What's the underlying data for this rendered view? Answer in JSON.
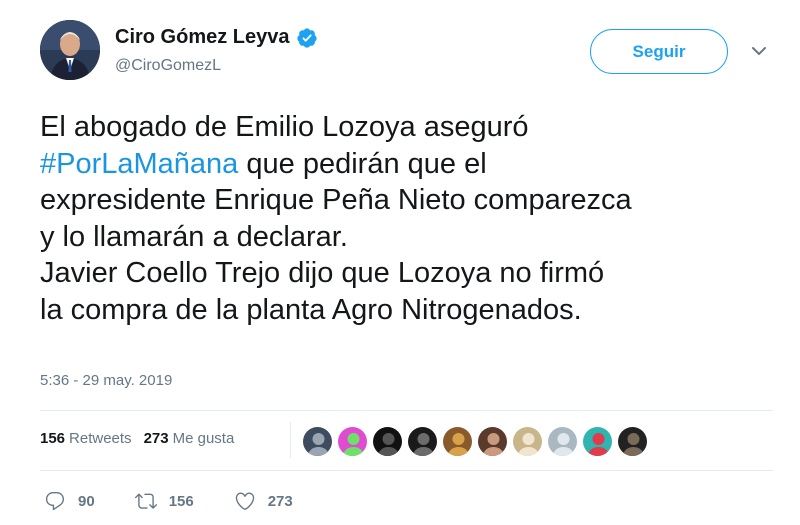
{
  "user": {
    "name": "Ciro Gómez Leyva",
    "handle": "@CiroGomezL",
    "verified": true
  },
  "follow_button": {
    "label": "Seguir"
  },
  "tweet": {
    "segments": [
      {
        "text": "El abogado de Emilio Lozoya aseguró\n",
        "hashtag": false
      },
      {
        "text": "#PorLaMañana",
        "hashtag": true
      },
      {
        "text": " que pedirán que el\nexpresidente Enrique Peña Nieto comparezca\ny lo llamarán a declarar.\nJavier Coello Trejo dijo que Lozoya no firmó\nla compra de la planta Agro Nitrogenados.",
        "hashtag": false
      }
    ],
    "timestamp": "5:36 - 29 may. 2019"
  },
  "stats": {
    "retweets_count": "156",
    "retweets_label": "Retweets",
    "likes_count": "273",
    "likes_label": "Me gusta"
  },
  "likers": [
    {
      "icon": "avatar-landscape",
      "colors": [
        "#3d4c5e",
        "#9aa5b1"
      ]
    },
    {
      "icon": "avatar-colorful-logo",
      "colors": [
        "#e04bd0",
        "#6ee06a"
      ]
    },
    {
      "icon": "avatar-dark-logo",
      "colors": [
        "#111111",
        "#555555"
      ]
    },
    {
      "icon": "avatar-dark-portrait",
      "colors": [
        "#1a1a1a",
        "#6b6b6b"
      ]
    },
    {
      "icon": "avatar-patterned",
      "colors": [
        "#8a5a2b",
        "#d8a24a"
      ]
    },
    {
      "icon": "avatar-portrait-woman",
      "colors": [
        "#5a3a2a",
        "#c99a80"
      ]
    },
    {
      "icon": "avatar-portrait-blonde",
      "colors": [
        "#c9b58a",
        "#f0e6d0"
      ]
    },
    {
      "icon": "avatar-default",
      "colors": [
        "#aab8c2",
        "#e1e8ed"
      ]
    },
    {
      "icon": "avatar-teal-character",
      "colors": [
        "#2fb5b0",
        "#e23a4a"
      ]
    },
    {
      "icon": "avatar-dark-portrait-2",
      "colors": [
        "#222222",
        "#7a6a5a"
      ]
    }
  ],
  "actions": {
    "replies": "90",
    "retweets": "156",
    "likes": "273"
  },
  "colors": {
    "accent": "#1da1f2",
    "hashtag": "#1b95e0",
    "secondary_text": "#657786",
    "divider": "#e6ecf0"
  }
}
